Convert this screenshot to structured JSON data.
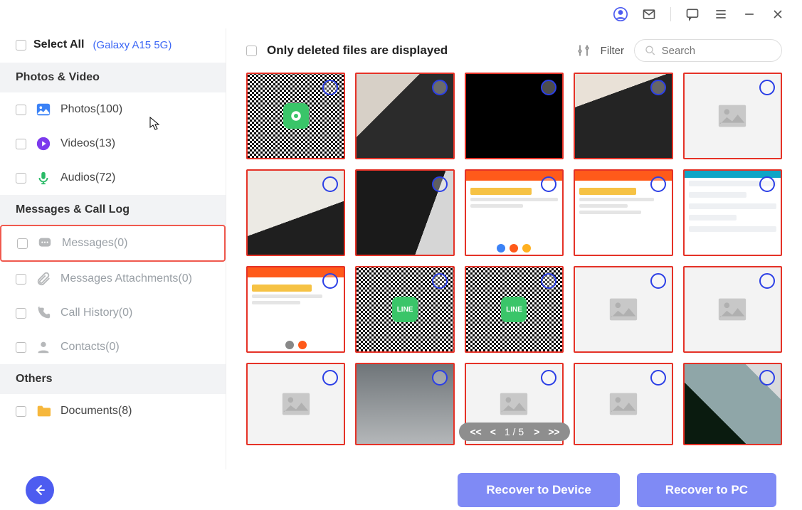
{
  "titlebar": {
    "icons": [
      "user-icon",
      "mail-icon",
      "chat-icon",
      "menu-icon",
      "minimize-icon",
      "close-icon"
    ]
  },
  "sidebar": {
    "select_all_label": "Select All",
    "device_name": "(Galaxy A15 5G)",
    "groups": [
      {
        "header": "Photos & Video",
        "items": [
          {
            "key": "photos",
            "label": "Photos(100)"
          },
          {
            "key": "videos",
            "label": "Videos(13)"
          },
          {
            "key": "audios",
            "label": "Audios(72)"
          }
        ]
      },
      {
        "header": "Messages & Call Log",
        "items": [
          {
            "key": "messages",
            "label": "Messages(0)",
            "highlight": true,
            "dim": true
          },
          {
            "key": "msg-att",
            "label": "Messages Attachments(0)",
            "dim": true
          },
          {
            "key": "call-history",
            "label": "Call History(0)",
            "dim": true
          },
          {
            "key": "contacts",
            "label": "Contacts(0)",
            "dim": true
          }
        ]
      },
      {
        "header": "Others",
        "items": [
          {
            "key": "documents",
            "label": "Documents(8)"
          }
        ]
      }
    ]
  },
  "toolbar": {
    "only_deleted_label": "Only deleted files are displayed",
    "filter_label": "Filter",
    "search_placeholder": "Search"
  },
  "pager": {
    "first": "< <",
    "prev": "<",
    "text": "1 / 5",
    "next": ">",
    "last": "> >"
  },
  "buttons": {
    "recover_device": "Recover to Device",
    "recover_pc": "Recover to PC"
  }
}
